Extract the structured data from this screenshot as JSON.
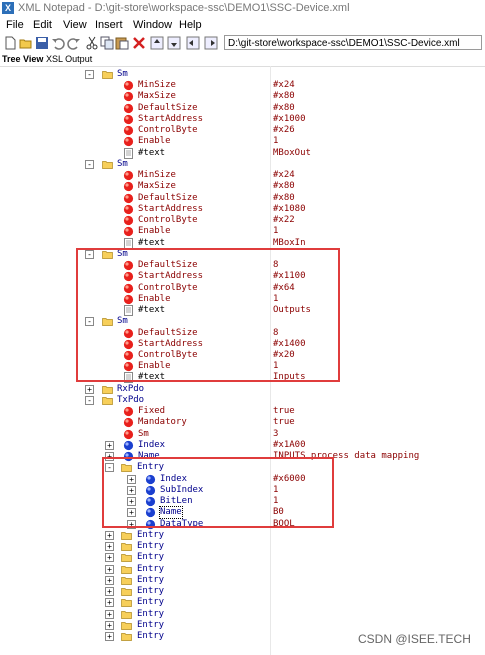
{
  "window": {
    "title": "XML Notepad - D:\\git-store\\workspace-ssc\\DEMO1\\SSC-Device.xml",
    "icon": "xml-notepad-icon"
  },
  "menu": [
    "File",
    "Edit",
    "View",
    "Insert",
    "Window",
    "Help"
  ],
  "toolbar": {
    "icons": [
      "new-icon",
      "open-icon",
      "save-icon",
      "undo-icon",
      "redo-icon",
      "cut-icon",
      "copy-icon",
      "paste-icon",
      "delete-icon",
      "nudge-up-icon",
      "nudge-down-icon",
      "nudge-left-icon",
      "nudge-right-icon"
    ],
    "path": "D:\\git-store\\workspace-ssc\\DEMO1\\SSC-Device.xml"
  },
  "tabs": [
    "Tree View",
    "XSL Output"
  ],
  "tree": [
    {
      "label": "Sm",
      "value": "",
      "kind": "el",
      "expand": "-"
    },
    {
      "label": "MinSize",
      "value": "#x24",
      "kind": "attr"
    },
    {
      "label": "MaxSize",
      "value": "#x80",
      "kind": "attr"
    },
    {
      "label": "DefaultSize",
      "value": "#x80",
      "kind": "attr"
    },
    {
      "label": "StartAddress",
      "value": "#x1000",
      "kind": "attr"
    },
    {
      "label": "ControlByte",
      "value": "#x26",
      "kind": "attr"
    },
    {
      "label": "Enable",
      "value": "1",
      "kind": "attr"
    },
    {
      "label": "#text",
      "value": "MBoxOut",
      "kind": "text"
    },
    {
      "label": "Sm",
      "value": "",
      "kind": "el",
      "expand": "-"
    },
    {
      "label": "MinSize",
      "value": "#x24",
      "kind": "attr"
    },
    {
      "label": "MaxSize",
      "value": "#x80",
      "kind": "attr"
    },
    {
      "label": "DefaultSize",
      "value": "#x80",
      "kind": "attr"
    },
    {
      "label": "StartAddress",
      "value": "#x1080",
      "kind": "attr"
    },
    {
      "label": "ControlByte",
      "value": "#x22",
      "kind": "attr"
    },
    {
      "label": "Enable",
      "value": "1",
      "kind": "attr"
    },
    {
      "label": "#text",
      "value": "MBoxIn",
      "kind": "text"
    },
    {
      "label": "Sm",
      "value": "",
      "kind": "el",
      "expand": "-"
    },
    {
      "label": "DefaultSize",
      "value": "8",
      "kind": "attr"
    },
    {
      "label": "StartAddress",
      "value": "#x1100",
      "kind": "attr"
    },
    {
      "label": "ControlByte",
      "value": "#x64",
      "kind": "attr"
    },
    {
      "label": "Enable",
      "value": "1",
      "kind": "attr"
    },
    {
      "label": "#text",
      "value": "Outputs",
      "kind": "text"
    },
    {
      "label": "Sm",
      "value": "",
      "kind": "el",
      "expand": "-"
    },
    {
      "label": "DefaultSize",
      "value": "8",
      "kind": "attr"
    },
    {
      "label": "StartAddress",
      "value": "#x1400",
      "kind": "attr"
    },
    {
      "label": "ControlByte",
      "value": "#x20",
      "kind": "attr"
    },
    {
      "label": "Enable",
      "value": "1",
      "kind": "attr"
    },
    {
      "label": "#text",
      "value": "Inputs",
      "kind": "text"
    },
    {
      "label": "RxPdo",
      "value": "",
      "kind": "el",
      "expand": "+"
    },
    {
      "label": "TxPdo",
      "value": "",
      "kind": "el",
      "expand": "-"
    },
    {
      "label": "Fixed",
      "value": "true",
      "kind": "attr"
    },
    {
      "label": "Mandatory",
      "value": "true",
      "kind": "attr"
    },
    {
      "label": "Sm",
      "value": "3",
      "kind": "attr"
    },
    {
      "label": "Index",
      "value": "#x1A00",
      "kind": "leaf",
      "expand": "+"
    },
    {
      "label": "Name",
      "value": "INPUTS process data mapping",
      "kind": "leaf",
      "expand": "+"
    },
    {
      "label": "Entry",
      "value": "",
      "kind": "el",
      "expand": "-"
    },
    {
      "label": "Index",
      "value": "#x6000",
      "kind": "leaf",
      "expand": "+"
    },
    {
      "label": "SubIndex",
      "value": "1",
      "kind": "leaf",
      "expand": "+"
    },
    {
      "label": "BitLen",
      "value": "1",
      "kind": "leaf",
      "expand": "+"
    },
    {
      "label": "Name",
      "value": "B0",
      "kind": "leaf",
      "expand": "+",
      "focus": true
    },
    {
      "label": "DataType",
      "value": "BOOL",
      "kind": "leaf",
      "expand": "+"
    },
    {
      "label": "Entry",
      "value": "",
      "kind": "el",
      "expand": "+"
    },
    {
      "label": "Entry",
      "value": "",
      "kind": "el",
      "expand": "+"
    },
    {
      "label": "Entry",
      "value": "",
      "kind": "el",
      "expand": "+"
    },
    {
      "label": "Entry",
      "value": "",
      "kind": "el",
      "expand": "+"
    },
    {
      "label": "Entry",
      "value": "",
      "kind": "el",
      "expand": "+"
    },
    {
      "label": "Entry",
      "value": "",
      "kind": "el",
      "expand": "+"
    },
    {
      "label": "Entry",
      "value": "",
      "kind": "el",
      "expand": "+"
    },
    {
      "label": "Entry",
      "value": "",
      "kind": "el",
      "expand": "+"
    },
    {
      "label": "Entry",
      "value": "",
      "kind": "el",
      "expand": "+"
    },
    {
      "label": "Entry",
      "value": "",
      "kind": "el",
      "expand": "+"
    }
  ],
  "highlight_color": "#e03c3c",
  "watermark": "CSDN @ISEE.TECH"
}
